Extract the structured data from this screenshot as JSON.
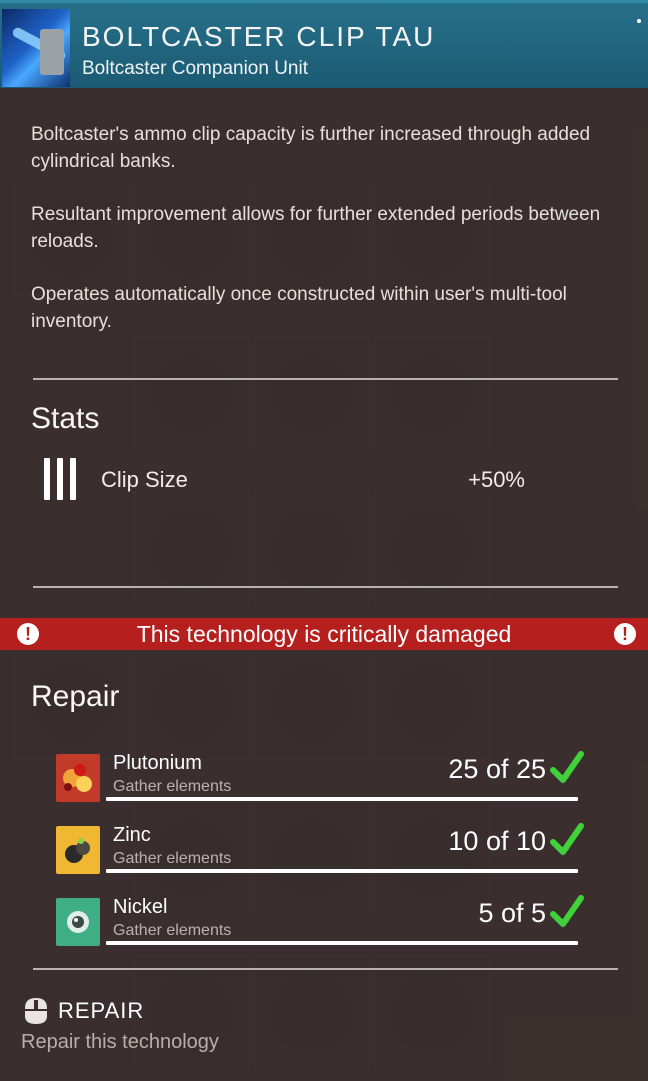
{
  "colors": {
    "header": "#1b5a72",
    "warning": "#b5201f",
    "check": "#3fd23a",
    "panel": "#3a2f2d"
  },
  "header": {
    "icon": "boltcaster-icon",
    "title": "BOLTCASTER CLIP TAU",
    "subtitle": "Boltcaster Companion Unit"
  },
  "description": [
    "Boltcaster's ammo clip capacity is further increased through added cylindrical banks.",
    "Resultant improvement allows for further extended periods between reloads.",
    "Operates automatically once constructed within user's multi-tool inventory."
  ],
  "stats": {
    "title": "Stats",
    "items": [
      {
        "icon": "clip-size-icon",
        "label": "Clip Size",
        "value": "+50%"
      }
    ]
  },
  "warning": {
    "icon": "exclamation-icon",
    "text": "This technology is critically damaged"
  },
  "repair": {
    "title": "Repair",
    "resources": [
      {
        "name": "Plutonium",
        "hint": "Gather elements",
        "count": "25 of 25",
        "icon": "plutonium-icon",
        "color": "#c23a2a",
        "complete": true
      },
      {
        "name": "Zinc",
        "hint": "Gather elements",
        "count": "10 of 10",
        "icon": "zinc-icon",
        "color": "#f0b733",
        "complete": true
      },
      {
        "name": "Nickel",
        "hint": "Gather elements",
        "count": "5 of 5",
        "icon": "nickel-icon",
        "color": "#3fae85",
        "complete": true
      }
    ]
  },
  "action": {
    "icon": "mouse-icon",
    "label": "REPAIR",
    "hint": "Repair this technology"
  }
}
